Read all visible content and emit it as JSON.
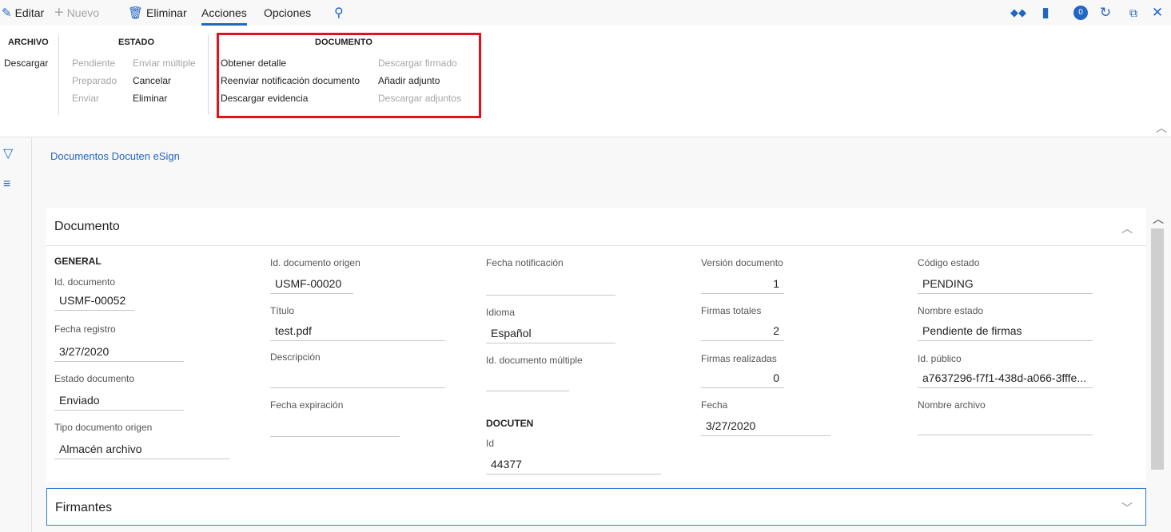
{
  "toolbar": {
    "editar": "Editar",
    "nuevo": "Nuevo",
    "eliminar": "Eliminar",
    "acciones": "Acciones",
    "opciones": "Opciones",
    "notification_count": "0"
  },
  "ribbon": {
    "archivo": {
      "title": "ARCHIVO",
      "descargar": "Descargar"
    },
    "estado": {
      "title": "ESTADO",
      "pendiente": "Pendiente",
      "preparado": "Preparado",
      "enviar": "Enviar",
      "enviar_multiple": "Enviar múltiple",
      "cancelar": "Cancelar",
      "eliminar": "Eliminar"
    },
    "documento": {
      "title": "DOCUMENTO",
      "obtener_detalle": "Obtener detalle",
      "reenviar": "Reenviar notificación documento",
      "descargar_evidencia": "Descargar evidencia",
      "descargar_firmado": "Descargar firmado",
      "anadir_adjunto": "Añadir adjunto",
      "descargar_adjuntos": "Descargar adjuntos"
    }
  },
  "page": {
    "link": "Documentos Docuten eSign"
  },
  "documento": {
    "title": "Documento",
    "general": "GENERAL",
    "id_documento": {
      "label": "Id. documento",
      "value": "USMF-00052"
    },
    "fecha_registro": {
      "label": "Fecha registro",
      "value": "3/27/2020"
    },
    "estado_documento": {
      "label": "Estado documento",
      "value": "Enviado"
    },
    "tipo_documento_origen": {
      "label": "Tipo documento origen",
      "value": "Almacén archivo"
    },
    "id_documento_origen": {
      "label": "Id. documento origen",
      "value": "USMF-00020"
    },
    "titulo": {
      "label": "Título",
      "value": "test.pdf"
    },
    "descripcion": {
      "label": "Descripción",
      "value": ""
    },
    "fecha_expiracion": {
      "label": "Fecha expiración",
      "value": ""
    },
    "fecha_notificacion": {
      "label": "Fecha notificación",
      "value": ""
    },
    "idioma": {
      "label": "Idioma",
      "value": "Español"
    },
    "id_documento_multiple": {
      "label": "Id. documento múltiple",
      "value": ""
    },
    "docuten": "DOCUTEN",
    "id": {
      "label": "Id",
      "value": "44377"
    },
    "version_documento": {
      "label": "Versión documento",
      "value": "1"
    },
    "firmas_totales": {
      "label": "Firmas totales",
      "value": "2"
    },
    "firmas_realizadas": {
      "label": "Firmas realizadas",
      "value": "0"
    },
    "fecha": {
      "label": "Fecha",
      "value": "3/27/2020"
    },
    "codigo_estado": {
      "label": "Código estado",
      "value": "PENDING"
    },
    "nombre_estado": {
      "label": "Nombre estado",
      "value": "Pendiente de firmas"
    },
    "id_publico": {
      "label": "Id. público",
      "value": "a7637296-f7f1-438d-a066-3fffe..."
    },
    "nombre_archivo": {
      "label": "Nombre archivo",
      "value": ""
    }
  },
  "firmantes": {
    "title": "Firmantes"
  },
  "colors": {
    "accent": "#2266c4",
    "highlight": "#e3111a"
  }
}
